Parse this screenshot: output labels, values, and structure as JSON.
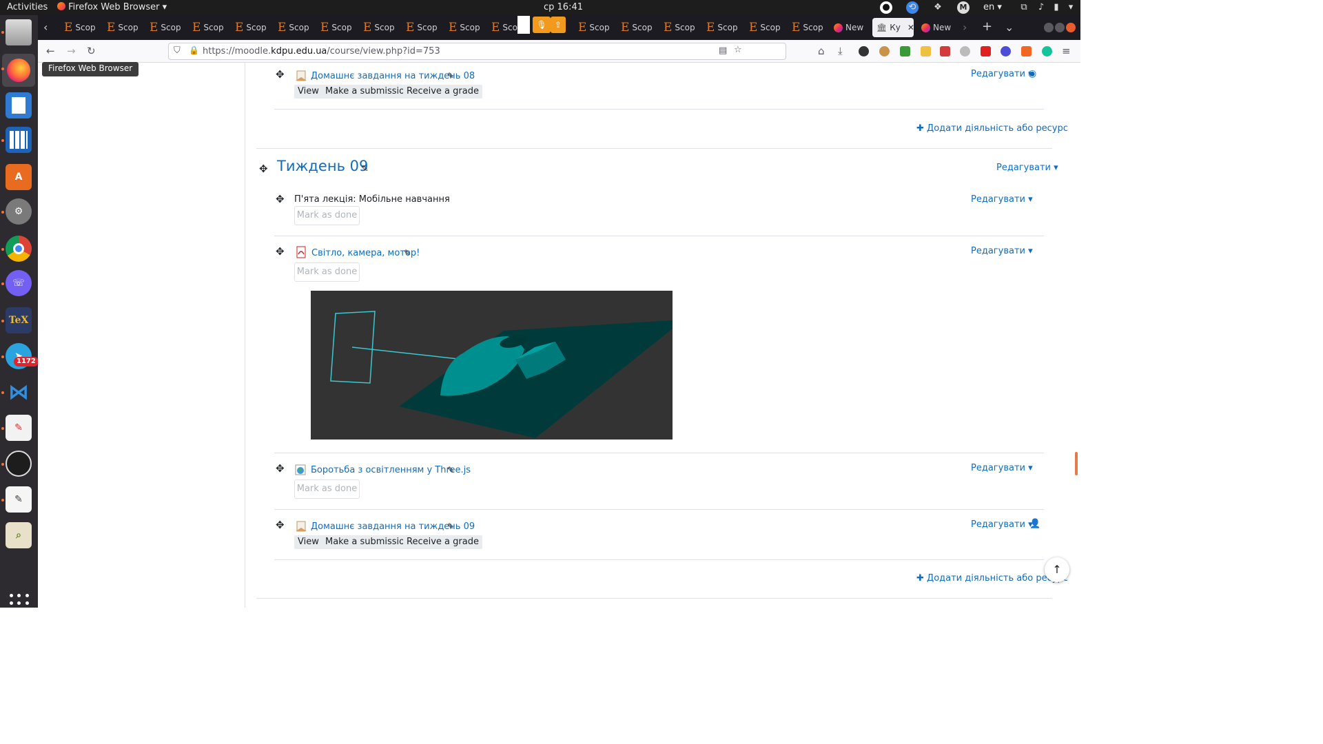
{
  "topbar": {
    "activities": "Activities",
    "app_name": "Firefox Web Browser",
    "clock": "ср 16:41",
    "keyboard_layout": "en",
    "profile_letter": "M"
  },
  "dock": {
    "telegram_badge": "1172",
    "tex_label": "TeX",
    "icons": [
      "files-icon",
      "firefox-icon",
      "libreoffice-writer-icon",
      "libreoffice-calc-icon",
      "software-center-icon",
      "settings-icon",
      "chrome-icon",
      "viber-icon",
      "texstudio-icon",
      "telegram-icon",
      "vscode-icon",
      "document-viewer-icon",
      "obs-icon",
      "text-editor-icon",
      "image-viewer-icon"
    ]
  },
  "tabs": {
    "scope_label": "Scop",
    "short_scope_label": "Sco",
    "new_tab_label": "New",
    "active_label": "Ку",
    "count_before_gap": 11,
    "count_after_gap": 6
  },
  "navbar": {
    "url_prefix": "https://moodle.",
    "url_domain": "kdpu.edu.ua",
    "url_path": "/course/view.php?id=753"
  },
  "tooltip": "Firefox Web Browser",
  "course": {
    "prev_assignment": {
      "title": "Домашнє завдання на тиждень 08",
      "buttons": [
        "View",
        "Make a submission",
        "Receive a grade"
      ]
    },
    "edit_label": "Редагувати",
    "add_activity": "Додати діяльність або ресурс",
    "section_title": "Тиждень 09",
    "label_activity": {
      "text": "П'ята лекція: Мобільне навчання",
      "button": "Mark as done"
    },
    "pdf_activity": {
      "title": "Світло, камера, мотор!",
      "button": "Mark as done"
    },
    "url_activity": {
      "title": "Боротьба з освітленням у Three.js",
      "button": "Mark as done"
    },
    "next_assignment": {
      "title": "Домашнє завдання на тиждень 09",
      "buttons": [
        "View",
        "Make a submission",
        "Receive a grade"
      ]
    }
  },
  "colors": {
    "link": "#0f6cbf",
    "scene_background": "#333333",
    "teal_object": "#008a8a",
    "camera_helper": "#3cc8d2"
  }
}
